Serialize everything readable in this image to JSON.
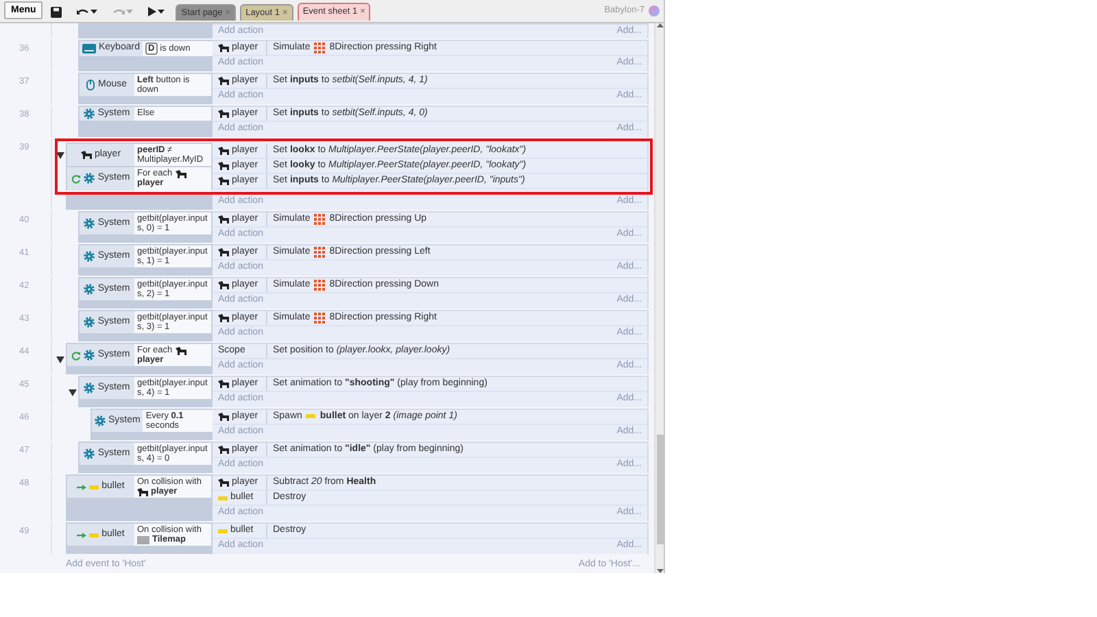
{
  "toolbar": {
    "menu": "Menu",
    "buttons": [
      {
        "kind": "save",
        "caret": false,
        "disabled": false
      },
      {
        "kind": "undo",
        "caret": true,
        "disabled": false
      },
      {
        "kind": "redo",
        "caret": true,
        "disabled": true
      },
      {
        "kind": "play",
        "caret": true,
        "disabled": false
      }
    ]
  },
  "tabs": [
    {
      "label": "Start page",
      "close": "×",
      "color": "#8e8e8e",
      "selected": false
    },
    {
      "label": "Layout 1",
      "close": "×",
      "color": "#cfc49d",
      "selected": false
    },
    {
      "label": "Event sheet 1",
      "close": "×",
      "color": "#f8d3d4",
      "selected": true
    }
  ],
  "user": {
    "name": "Babylon-7"
  },
  "events": [
    {
      "kind": "fragment",
      "children": [
        {
          "kind": "tail",
          "add_action": "Add action",
          "add_more": "Add..."
        },
        {
          "kind": "event",
          "number": "36",
          "conditions": [
            {
              "kind": "keyboard",
              "object": "Keyboard",
              "key": "D",
              "text": "is down"
            }
          ],
          "actions": [
            {
              "kind": "sprite",
              "object": "player",
              "parts": [
                {
                  "kind": "text",
                  "text": "Simulate"
                },
                {
                  "kind": "grid"
                },
                {
                  "kind": "text",
                  "text": "8Direction pressing Right"
                }
              ]
            }
          ],
          "add_action": "Add action",
          "add_more": "Add..."
        },
        {
          "kind": "event",
          "number": "37",
          "conditions": [
            {
              "kind": "mouse",
              "object": "Mouse",
              "text": "**Left** button is down"
            }
          ],
          "actions": [
            {
              "kind": "sprite",
              "object": "player",
              "parts": [
                {
                  "kind": "text",
                  "text": "Set **inputs** to *setbit(Self.inputs, 4, 1)*"
                }
              ]
            }
          ],
          "add_action": "Add action",
          "add_more": "Add..."
        },
        {
          "kind": "event",
          "number": "38",
          "conditions": [
            {
              "kind": "system",
              "object": "System",
              "text": "Else"
            }
          ],
          "actions": [
            {
              "kind": "sprite",
              "object": "player",
              "parts": [
                {
                  "kind": "text",
                  "text": "Set **inputs** to *setbit(Self.inputs, 4, 0)*"
                }
              ]
            }
          ],
          "add_action": "Add action",
          "add_more": "Add..."
        }
      ]
    },
    {
      "kind": "event",
      "number": "39",
      "expanded": true,
      "highlighted": true,
      "conditions": [
        {
          "kind": "sprite",
          "object": "player",
          "text": "**peerID** ≠ Multiplayer.MyID"
        },
        {
          "kind": "system",
          "looping": true,
          "object": "System",
          "text": "For each",
          "param": {
            "kind": "sprite",
            "name": "player"
          }
        }
      ],
      "actions": [
        {
          "kind": "sprite",
          "object": "player",
          "parts": [
            {
              "kind": "text",
              "text": "Set **lookx** to *Multiplayer.PeerState(player.peerID, \"lookatx\")*"
            }
          ]
        },
        {
          "kind": "sprite",
          "object": "player",
          "parts": [
            {
              "kind": "text",
              "text": "Set **looky** to *Multiplayer.PeerState(player.peerID, \"lookaty\")*"
            }
          ]
        },
        {
          "kind": "sprite",
          "object": "player",
          "parts": [
            {
              "kind": "text",
              "text": "Set **inputs** to *Multiplayer.PeerState(player.peerID, \"inputs\")*"
            }
          ]
        }
      ],
      "add_action": "Add action",
      "add_more": "Add...",
      "children": [
        {
          "kind": "event",
          "number": "40",
          "conditions": [
            {
              "kind": "system",
              "object": "System",
              "text": "getbit(player.inputs, 0) = 1"
            }
          ],
          "actions": [
            {
              "kind": "sprite",
              "object": "player",
              "parts": [
                {
                  "kind": "text",
                  "text": "Simulate"
                },
                {
                  "kind": "grid"
                },
                {
                  "kind": "text",
                  "text": "8Direction pressing Up"
                }
              ]
            }
          ],
          "add_action": "Add action",
          "add_more": "Add..."
        },
        {
          "kind": "event",
          "number": "41",
          "conditions": [
            {
              "kind": "system",
              "object": "System",
              "text": "getbit(player.inputs, 1) = 1"
            }
          ],
          "actions": [
            {
              "kind": "sprite",
              "object": "player",
              "parts": [
                {
                  "kind": "text",
                  "text": "Simulate"
                },
                {
                  "kind": "grid"
                },
                {
                  "kind": "text",
                  "text": "8Direction pressing Left"
                }
              ]
            }
          ],
          "add_action": "Add action",
          "add_more": "Add..."
        },
        {
          "kind": "event",
          "number": "42",
          "conditions": [
            {
              "kind": "system",
              "object": "System",
              "text": "getbit(player.inputs, 2) = 1"
            }
          ],
          "actions": [
            {
              "kind": "sprite",
              "object": "player",
              "parts": [
                {
                  "kind": "text",
                  "text": "Simulate"
                },
                {
                  "kind": "grid"
                },
                {
                  "kind": "text",
                  "text": "8Direction pressing Down"
                }
              ]
            }
          ],
          "add_action": "Add action",
          "add_more": "Add..."
        },
        {
          "kind": "event",
          "number": "43",
          "conditions": [
            {
              "kind": "system",
              "object": "System",
              "text": "getbit(player.inputs, 3) = 1"
            }
          ],
          "actions": [
            {
              "kind": "sprite",
              "object": "player",
              "parts": [
                {
                  "kind": "text",
                  "text": "Simulate"
                },
                {
                  "kind": "grid"
                },
                {
                  "kind": "text",
                  "text": "8Direction pressing Right"
                }
              ]
            }
          ],
          "add_action": "Add action",
          "add_more": "Add..."
        }
      ]
    },
    {
      "kind": "event",
      "number": "44",
      "expanded": true,
      "conditions": [
        {
          "kind": "system",
          "looping": true,
          "object": "System",
          "text": "For each",
          "param": {
            "kind": "sprite",
            "name": "player"
          }
        }
      ],
      "actions": [
        {
          "kind": "none",
          "object": "Scope",
          "parts": [
            {
              "kind": "text",
              "text": "Set position to *(player.lookx, player.looky)*"
            }
          ]
        }
      ],
      "add_action": "Add action",
      "add_more": "Add...",
      "children": [
        {
          "kind": "event",
          "number": "45",
          "expanded": true,
          "conditions": [
            {
              "kind": "system",
              "object": "System",
              "text": "getbit(player.inputs, 4) = 1"
            }
          ],
          "actions": [
            {
              "kind": "sprite",
              "object": "player",
              "parts": [
                {
                  "kind": "text",
                  "text": "Set animation to **\"shooting\"** (play from beginning)"
                }
              ]
            }
          ],
          "add_action": "Add action",
          "add_more": "Add...",
          "children": [
            {
              "kind": "event",
              "number": "46",
              "conditions": [
                {
                  "kind": "system",
                  "object": "System",
                  "text": "Every **0.1** seconds"
                }
              ],
              "actions": [
                {
                  "kind": "sprite",
                  "object": "player",
                  "parts": [
                    {
                      "kind": "text",
                      "text": "Spawn"
                    },
                    {
                      "kind": "bar"
                    },
                    {
                      "kind": "text",
                      "text": "**bullet** on layer **2** *(image point 1)*"
                    }
                  ]
                }
              ],
              "add_action": "Add action",
              "add_more": "Add..."
            }
          ]
        },
        {
          "kind": "event",
          "number": "47",
          "conditions": [
            {
              "kind": "system",
              "object": "System",
              "text": "getbit(player.inputs, 4) = 0"
            }
          ],
          "actions": [
            {
              "kind": "sprite",
              "object": "player",
              "parts": [
                {
                  "kind": "text",
                  "text": "Set animation to **\"idle\"** (play from beginning)"
                }
              ]
            }
          ],
          "add_action": "Add action",
          "add_more": "Add..."
        }
      ]
    },
    {
      "kind": "event",
      "number": "48",
      "conditions": [
        {
          "kind": "bullet",
          "triggered": true,
          "object": "bullet",
          "text": "On collision with",
          "param": {
            "kind": "sprite",
            "name": "player"
          }
        }
      ],
      "actions": [
        {
          "kind": "sprite",
          "object": "player",
          "parts": [
            {
              "kind": "text",
              "text": "Subtract *20* from **Health**"
            }
          ]
        },
        {
          "kind": "bullet",
          "object": "bullet",
          "parts": [
            {
              "kind": "text",
              "text": "Destroy"
            }
          ]
        }
      ],
      "add_action": "Add action",
      "add_more": "Add..."
    },
    {
      "kind": "event",
      "number": "49",
      "conditions": [
        {
          "kind": "bullet",
          "triggered": true,
          "object": "bullet",
          "text": "On collision with",
          "param": {
            "kind": "tilemap",
            "name": "Tilemap"
          }
        }
      ],
      "actions": [
        {
          "kind": "bullet",
          "object": "bullet",
          "parts": [
            {
              "kind": "text",
              "text": "Destroy"
            }
          ]
        }
      ],
      "add_action": "Add action",
      "add_more": "Add..."
    }
  ],
  "footer": {
    "add_event": "Add event to 'Host'",
    "add_to": "Add to 'Host'..."
  }
}
